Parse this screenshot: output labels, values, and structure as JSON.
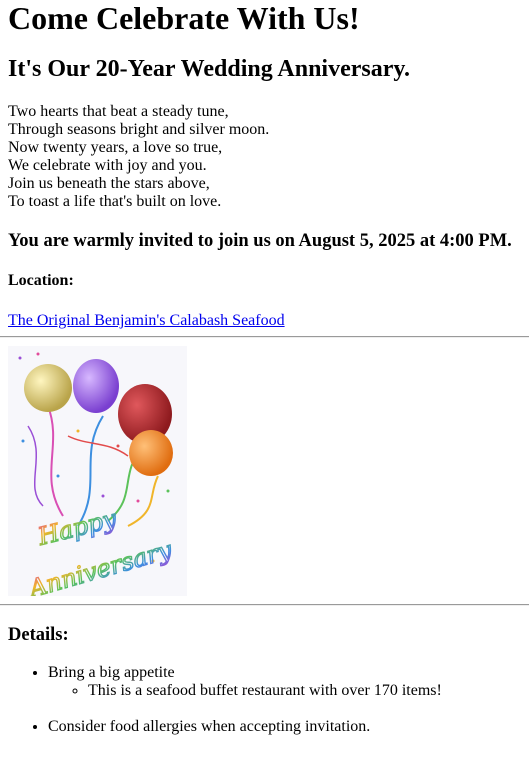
{
  "header": {
    "title": "Come Celebrate With Us!",
    "subtitle": "It's Our 20-Year Wedding Anniversary."
  },
  "poem": {
    "lines": [
      "Two hearts that beat a steady tune,",
      "Through seasons bright and silver moon.",
      "Now twenty years, a love so true,",
      "We celebrate with joy and you.",
      "Join us beneath the stars above,",
      "To toast a life that's built on love."
    ]
  },
  "invite": {
    "text": "You are warmly invited to join us on August 5, 2025 at 4:00 PM."
  },
  "location": {
    "label": "Location:",
    "link_text": "The Original Benjamin's Calabash Seafood"
  },
  "card": {
    "line1": "Happy",
    "line2": "Anniversary",
    "colors": {
      "gold": "#d9c86a",
      "purple": "#9b5fe0",
      "red": "#b3262a",
      "orange": "#f08a24",
      "background": "#f7f7fb"
    }
  },
  "details": {
    "heading": "Details:",
    "items": [
      {
        "text": "Bring a big appetite",
        "sub": [
          "This is a seafood buffet restaurant with over 170 items!"
        ]
      },
      {
        "text": "Consider food allergies when accepting invitation."
      }
    ]
  }
}
